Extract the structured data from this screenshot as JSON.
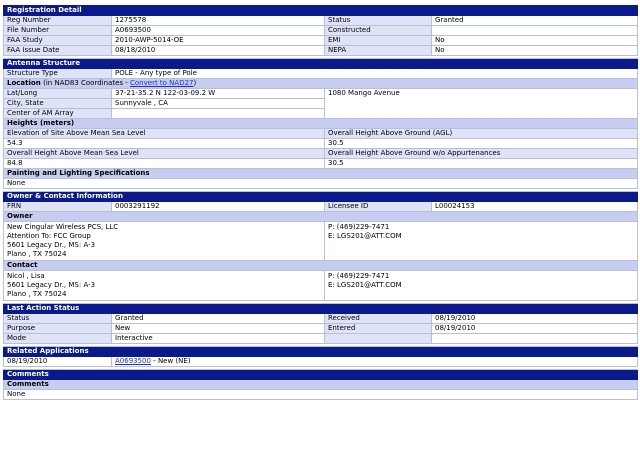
{
  "registration": {
    "title": "Registration Detail",
    "rows": [
      {
        "l1": "Reg Number",
        "v1": "1275578",
        "l2": "Status",
        "v2": "Granted"
      },
      {
        "l1": "File Number",
        "v1": "A0693500",
        "l2": "Constructed",
        "v2": ""
      },
      {
        "l1": "FAA Study",
        "v1": "2010-AWP-5014-OE",
        "l2": "EMI",
        "v2": "No"
      },
      {
        "l1": "FAA Issue Date",
        "v1": "08/18/2010",
        "l2": "NEPA",
        "v2": "No"
      }
    ]
  },
  "antenna": {
    "title": "Antenna Structure",
    "structure_type_label": "Structure Type",
    "structure_type_value": "POLE - Any type of Pole",
    "location_label": "Location",
    "location_note": "(in NAD83 Coordinates - ",
    "convert_link": "Convert to NAD27",
    "location_note_end": ")",
    "latlong_label": "Lat/Long",
    "latlong_value": "37-21-35.2 N 122-03-09.2 W",
    "address": "1080 Mango Avenue",
    "city_label": "City, State",
    "city_value": "Sunnyvale , CA",
    "am_label": "Center of AM Array",
    "am_value": ""
  },
  "heights": {
    "title": "Heights (meters)",
    "elev_label": "Elevation of Site Above Mean Sea Level",
    "elev_value": "54.3",
    "agl_label": "Overall Height Above Ground (AGL)",
    "agl_value": "30.5",
    "amsl_label": "Overall Height Above Mean Sea Level",
    "amsl_value": "84.8",
    "noapp_label": "Overall Height Above Ground w/o Appurtenances",
    "noapp_value": "30.5"
  },
  "painting": {
    "title": "Painting and Lighting Specifications",
    "value": "None"
  },
  "owner_contact": {
    "title": "Owner & Contact Information",
    "frn_label": "FRN",
    "frn_value": "0003291192",
    "licensee_label": "Licensee ID",
    "licensee_value": "L00024153",
    "owner_title": "Owner",
    "owner_lines": [
      "New Cingular Wireless PCS, LLC",
      "Attention To: FCC Group",
      "5601 Legacy Dr., MS: A-3",
      "Plano , TX 75024"
    ],
    "owner_phone": "P: (469)229-7471",
    "owner_email": "E: LGS201@ATT.COM",
    "contact_title": "Contact",
    "contact_lines": [
      "Nicol , Lisa",
      "5601 Legacy Dr., MS: A-3",
      "Plano , TX 75024"
    ],
    "contact_phone": "P: (469)229-7471",
    "contact_email": "E: LGS201@ATT.COM"
  },
  "last_action": {
    "title": "Last Action Status",
    "rows": [
      {
        "l1": "Status",
        "v1": "Granted",
        "l2": "Received",
        "v2": "08/19/2010"
      },
      {
        "l1": "Purpose",
        "v1": "New",
        "l2": "Entered",
        "v2": "08/19/2010"
      },
      {
        "l1": "Mode",
        "v1": "Interactive",
        "l2": "",
        "v2": ""
      }
    ]
  },
  "related": {
    "title": "Related Applications",
    "date": "08/19/2010",
    "link": "A0693500",
    "suffix": " - New (NE)"
  },
  "comments": {
    "title": "Comments",
    "sub_title": "Comments",
    "value": "None"
  }
}
